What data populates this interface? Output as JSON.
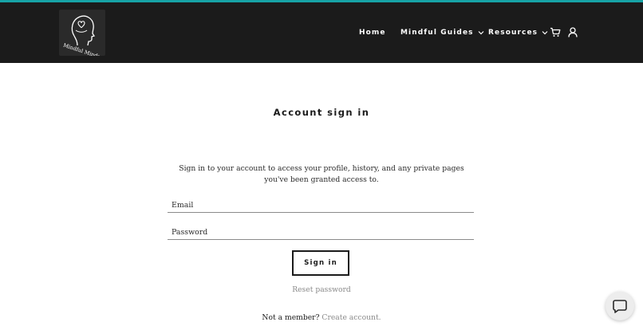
{
  "brand": {
    "logo_text": "Mindful Minds"
  },
  "nav": {
    "home": "Home",
    "guides": "Mindful Guides",
    "resources": "Resources",
    "cart_icon": "cart-icon",
    "account_icon": "user-icon"
  },
  "page": {
    "title": "Account sign in",
    "intro": "Sign in to your account to access your profile, history, and any private pages you've been granted access to."
  },
  "form": {
    "email_placeholder": "Email",
    "password_placeholder": "Password",
    "signin_label": "Sign in",
    "reset_label": "Reset password",
    "member_prompt": "Not a member?",
    "create_label": "Create account."
  },
  "chat": {
    "icon": "chat-bubble-icon"
  },
  "colors": {
    "accent": "#17a3a6",
    "header_bg": "#1b1b1b",
    "muted_text": "#8a8a8a"
  }
}
